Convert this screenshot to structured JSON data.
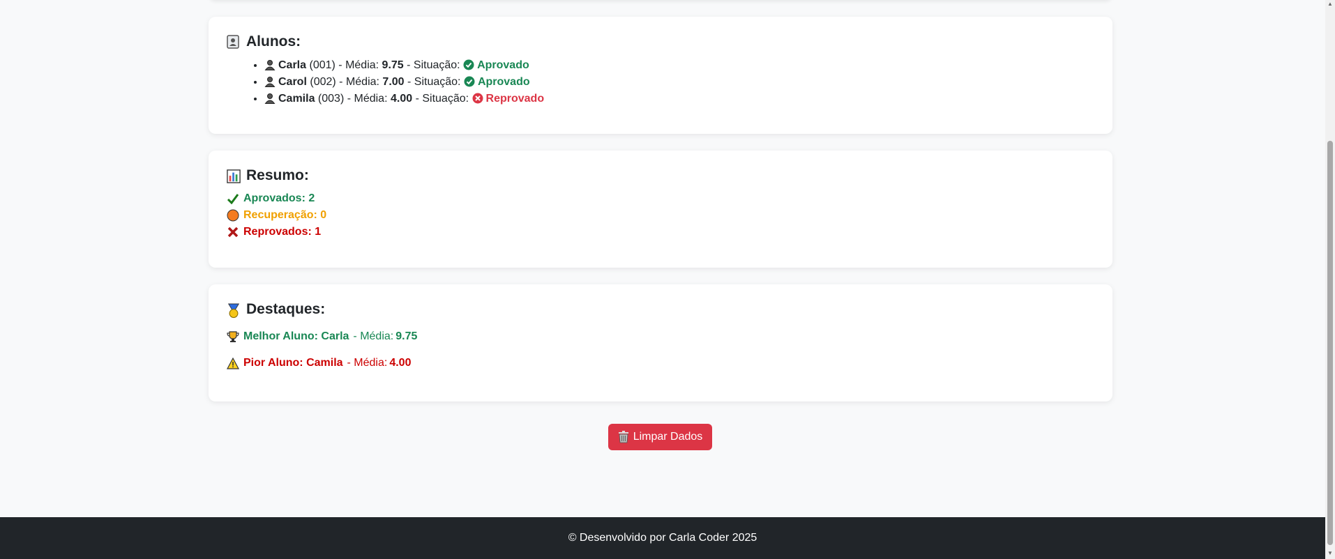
{
  "students_card": {
    "title": "Alunos:",
    "title_icon": "id-card-icon",
    "media_label": "Média:",
    "status_label": "Situação:",
    "items": [
      {
        "name": "Carla",
        "id": "(001)",
        "media": "9.75",
        "status": "Aprovado",
        "approved": true
      },
      {
        "name": "Carol",
        "id": "(002)",
        "media": "7.00",
        "status": "Aprovado",
        "approved": true
      },
      {
        "name": "Camila",
        "id": "(003)",
        "media": "4.00",
        "status": "Reprovado",
        "approved": false
      }
    ]
  },
  "summary_card": {
    "title": "Resumo:",
    "title_icon": "bar-chart-icon",
    "approved": "Aprovados: 2",
    "recovery": "Recuperação: 0",
    "failed": "Reprovados: 1"
  },
  "highlights_card": {
    "title": "Destaques:",
    "title_icon": "medal-icon",
    "best_label": "Melhor Aluno: Carla",
    "best_media_label": "- Média:",
    "best_media": "9.75",
    "worst_label": "Pior Aluno: Camila",
    "worst_media_label": "- Média:",
    "worst_media": "4.00"
  },
  "clear_button": {
    "label": "Limpar Dados",
    "icon": "trash-icon"
  },
  "footer": {
    "text": "© Desenvolvido por Carla Coder 2025"
  },
  "colors": {
    "approved": "#198754",
    "failed": "#dc3545",
    "recovery": "#f0a000",
    "footer_bg": "#212529",
    "button_bg": "#dc3545"
  }
}
